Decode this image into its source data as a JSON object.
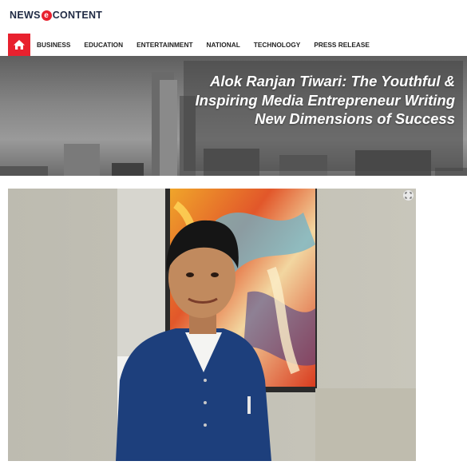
{
  "header": {
    "logo_left": "NEWS",
    "logo_letter": "e",
    "logo_right": "CONTENT"
  },
  "nav": {
    "home_icon": "home-icon",
    "items": [
      "BUSINESS",
      "EDUCATION",
      "ENTERTAINMENT",
      "NATIONAL",
      "TECHNOLOGY",
      "PRESS RELEASE"
    ]
  },
  "hero": {
    "title": "Alok Ranjan Tiwari: The Youthful & Inspiring Media Entrepreneur Writing New Dimensions of Success"
  },
  "photo": {
    "subject": "portrait photo of man in blue vest",
    "expand_icon": "expand-icon"
  },
  "colors": {
    "accent": "#e8212e",
    "logo_text": "#1f2a44",
    "vest": "#1d3f7c"
  }
}
